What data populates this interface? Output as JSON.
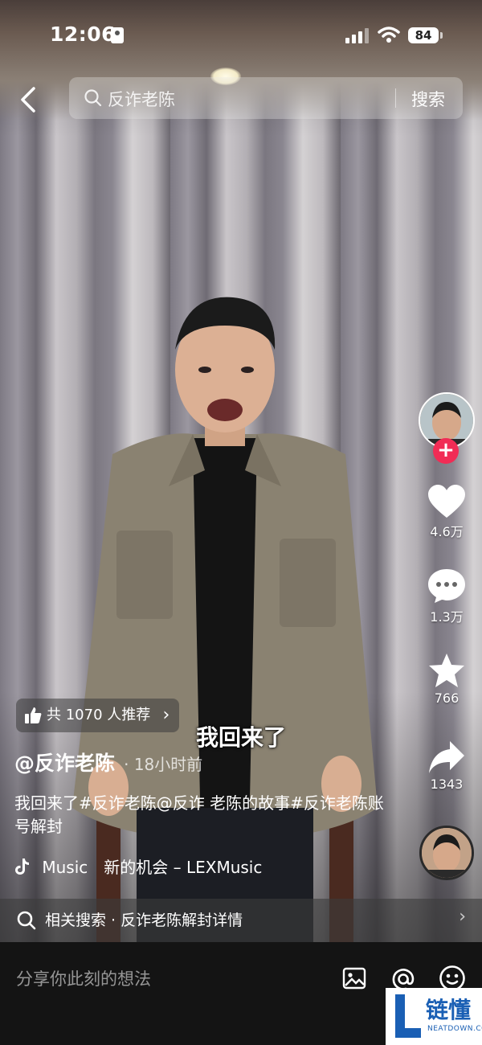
{
  "status_bar": {
    "time": "12:06",
    "battery": "84"
  },
  "search": {
    "query": "反诈老陈",
    "button_label": "搜索"
  },
  "rail": {
    "likes": "4.6万",
    "comments": "1.3万",
    "favorites": "766",
    "shares": "1343"
  },
  "video": {
    "recommend_label": "共 1070 人推荐",
    "subtitle": "我回来了",
    "author": "@反诈老陈",
    "post_time": "· 18小时前",
    "caption": "我回来了#反诈老陈@反诈 老陈的故事#反诈老陈账号解封",
    "music": "Music　新的机会 – LEXMusic"
  },
  "related": {
    "label": "相关搜索 · 反诈老陈解封详情"
  },
  "comment_bar": {
    "placeholder": "分享你此刻的想法"
  },
  "watermark": {
    "text": "链懂",
    "sub": "NEATDOWN.COM"
  },
  "colors": {
    "follow_accent": "#f12c55",
    "watermark_blue": "#1a5fb4"
  }
}
